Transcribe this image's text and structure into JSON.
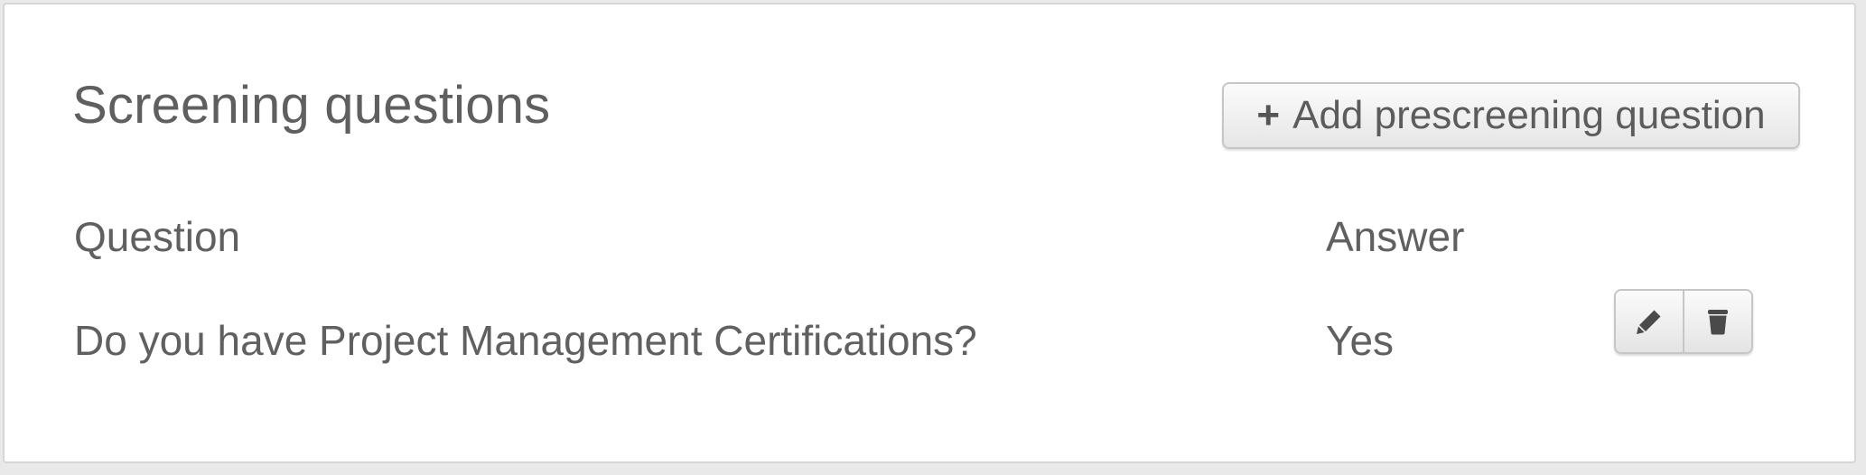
{
  "section": {
    "title": "Screening questions",
    "add_button": {
      "icon": "plus-icon",
      "icon_glyph": "+",
      "label": "Add prescreening question"
    }
  },
  "table": {
    "headers": [
      "Question",
      "Answer"
    ],
    "rows": [
      {
        "question": "Do you have Project Management Certifications?",
        "answer": "Yes",
        "actions": [
          "pencil-icon",
          "trash-icon"
        ]
      }
    ]
  },
  "colors": {
    "text": "#5f5f5f",
    "border": "#d6d6d6",
    "button_border": "#c6c6c6"
  }
}
